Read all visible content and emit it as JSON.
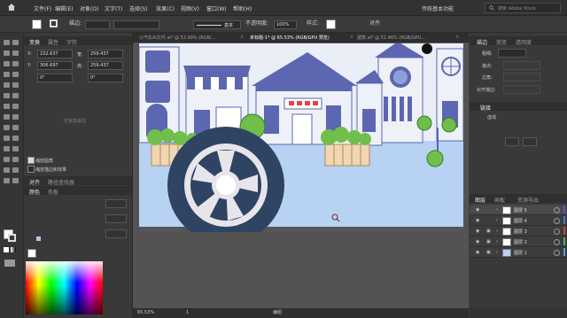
{
  "menubar": {
    "items": [
      "文件(F)",
      "编辑(E)",
      "对象(O)",
      "文字(T)",
      "选择(S)",
      "效果(C)",
      "视图(V)",
      "窗口(W)",
      "帮助(H)"
    ],
    "workspace": "传统基本功能",
    "search_placeholder": "搜索 Adobe Stock"
  },
  "control_bar": {
    "fill_label": "描边:",
    "stroke_style": "基本",
    "opacity_label": "不透明度:",
    "opacity_value": "100%",
    "style_label": "样式:",
    "align_label": "对齐"
  },
  "transform_panel": {
    "tabs": [
      "变换",
      "属性",
      "字符"
    ],
    "x_label": "X:",
    "x_value": "232.637",
    "y_label": "Y:",
    "y_value": "306.697",
    "w_label": "宽:",
    "w_value": "259.437",
    "h_label": "高:",
    "h_value": "259.437",
    "angle1": "0°",
    "angle2": "0°",
    "no_selection": "无状态属性",
    "opt_scale_corners": "缩放圆角",
    "opt_scale_strokes": "缩放描边和效果"
  },
  "align_panel": {
    "tabs": [
      "对齐",
      "路径查找器"
    ]
  },
  "color_panel": {
    "tabs": [
      "颜色",
      "色板"
    ]
  },
  "document_tabs": [
    {
      "label": "小汽车AI文件.ai* @ 52.99% (RGB/...",
      "close": "×"
    },
    {
      "label": "未标题-1* @ 65.53% (RGB/GPU 预览)",
      "close": "×",
      "active": true
    },
    {
      "label": "建筑.ai* @ 51.46% (RGB/GPU...",
      "close": "×"
    }
  ],
  "status_bar": {
    "zoom": "65.53%",
    "artboard": "1",
    "mode": "编组"
  },
  "right_panel": {
    "tabs_top": [
      "描边",
      "渐变",
      "透明度"
    ],
    "weight_label": "粗细:",
    "cap_label": "端点:",
    "corner_label": "边角:",
    "align_stroke_label": "对齐描边:",
    "dashed_label": "虚线",
    "links_tab": "链接",
    "layers_tabs": [
      "图层",
      "画板",
      "资源导出"
    ],
    "layers": [
      {
        "name": "图层 5",
        "color": "#6a4bd8"
      },
      {
        "name": "图层 4",
        "color": "#3b7be0"
      },
      {
        "name": "图层 3",
        "color": "#e03b3b"
      },
      {
        "name": "图层 2",
        "color": "#46b84b"
      },
      {
        "name": "图层 1",
        "color": "#4aa3e0"
      }
    ]
  },
  "icons": [
    "home-icon",
    "search-icon",
    "zoom-cursor-icon",
    "eye-icon",
    "lock-icon"
  ],
  "colors": {
    "sky": "#b7d2f3",
    "road": "#565656",
    "building_blue": "#5d66b0",
    "tire": "#2f4463",
    "bush_green": "#6fbf4a",
    "fence": "#f1d6b2"
  }
}
